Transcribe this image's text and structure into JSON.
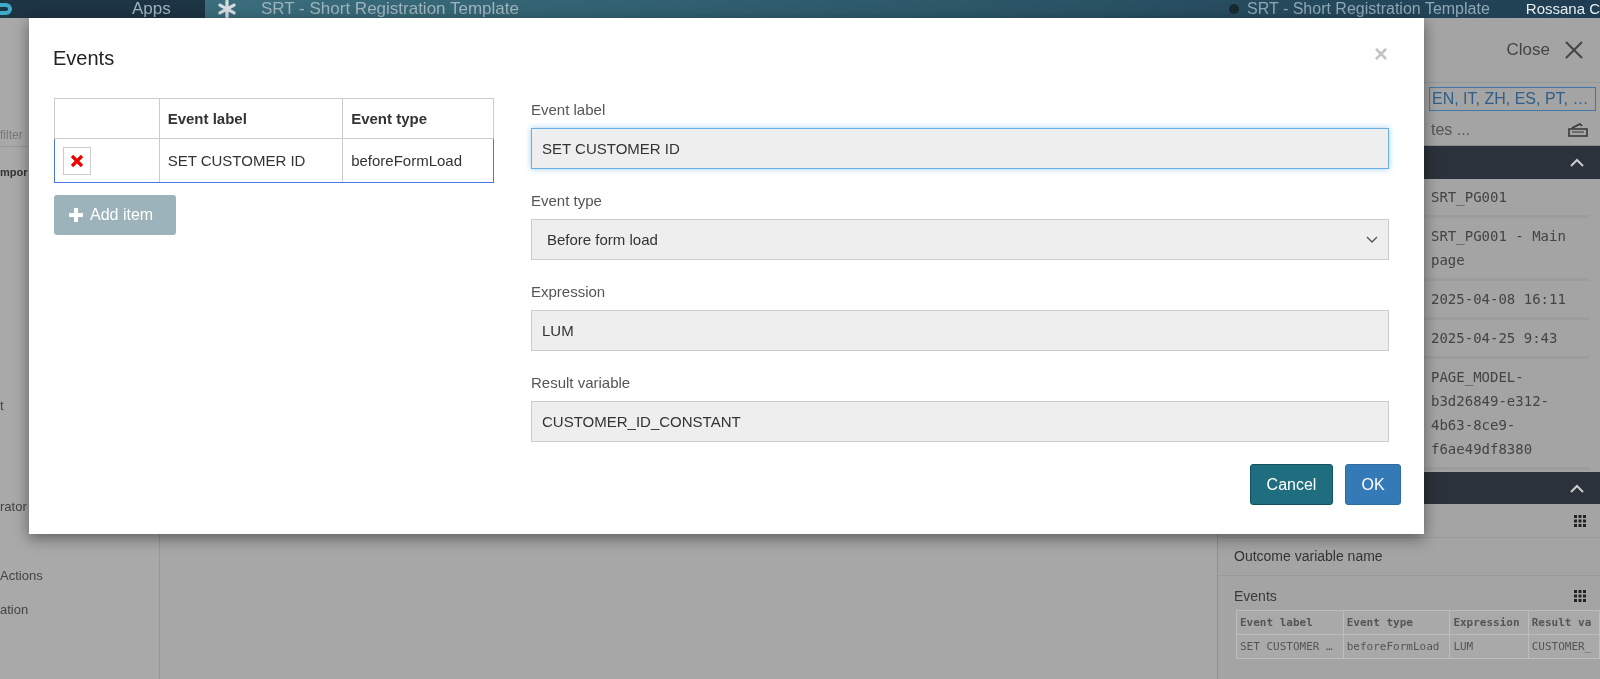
{
  "top_bar": {
    "apps": "Apps",
    "app_title": "SRT - Short Registration Template",
    "context": "SRT - Short Registration Template",
    "user": "Rossana C"
  },
  "sidebar": {
    "filter_placeholder": "filter",
    "items": [
      {
        "label": "mpor",
        "kind": "heading"
      },
      {
        "label": "t",
        "kind": "item"
      },
      {
        "label": "rator",
        "kind": "item"
      },
      {
        "label": "Actions",
        "kind": "item"
      },
      {
        "label": "ation",
        "kind": "item"
      }
    ]
  },
  "right_panel": {
    "close": "Close",
    "languages": "EN, IT, ZH, ES, PT, …",
    "notes": "tes ...",
    "properties": [
      "SRT_PG001",
      "SRT_PG001 - Main page",
      "2025-04-08 16:11",
      "2025-04-25 9:43",
      "PAGE_MODEL-b3d26849-e312-4b63-8ce9-f6ae49df8380"
    ],
    "outcome_label": "Outcome variable name",
    "events": {
      "title": "Events",
      "columns": [
        "Event label",
        "Event type",
        "Expression",
        "Result va"
      ],
      "rows": [
        [
          "SET CUSTOMER …",
          "beforeFormLoad",
          "LUM",
          "CUSTOMER_"
        ]
      ]
    }
  },
  "dialog": {
    "title": "Events",
    "close": "×",
    "table": {
      "columns": [
        "Event label",
        "Event type"
      ],
      "rows": [
        {
          "label": "SET CUSTOMER ID",
          "type": "beforeFormLoad",
          "selected": true
        }
      ]
    },
    "add_button": "Add item",
    "fields": [
      {
        "label": "Event label",
        "kind": "text",
        "value": "SET CUSTOMER ID",
        "focused": true
      },
      {
        "label": "Event type",
        "kind": "select",
        "value": "Before form load",
        "focused": false
      },
      {
        "label": "Expression",
        "kind": "text",
        "value": "LUM",
        "focused": false
      },
      {
        "label": "Result variable",
        "kind": "text",
        "value": "CUSTOMER_ID_CONSTANT",
        "focused": false
      }
    ],
    "buttons": [
      {
        "label": "Cancel",
        "kind": "secondary"
      },
      {
        "label": "OK",
        "kind": "primary"
      }
    ]
  }
}
